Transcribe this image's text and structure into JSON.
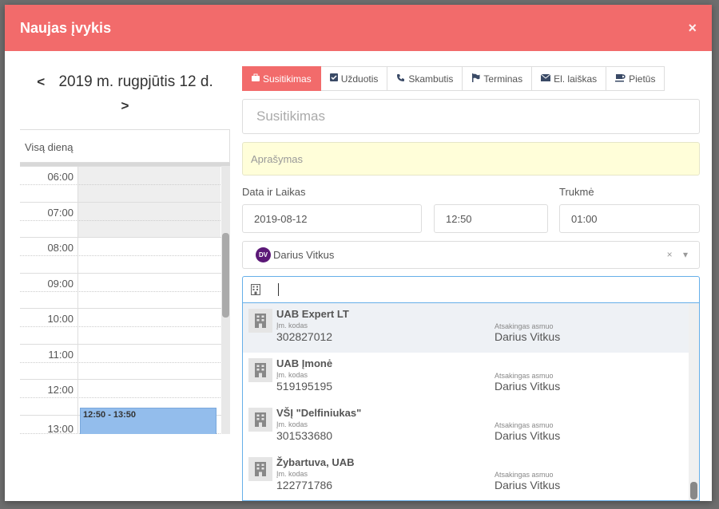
{
  "modal": {
    "title": "Naujas įvykis",
    "close": "×"
  },
  "calendar": {
    "date": "2019 m. rugpjūtis 12 d.",
    "prev": "<",
    "next": ">",
    "allday_label": "Visą dieną",
    "hours": [
      "06:00",
      "07:00",
      "08:00",
      "09:00",
      "10:00",
      "11:00",
      "12:00",
      "13:00"
    ],
    "event_label": "12:50 - 13:50"
  },
  "tabs": [
    {
      "label": "Susitikimas",
      "icon": "briefcase-icon"
    },
    {
      "label": "Užduotis",
      "icon": "checkbox-icon"
    },
    {
      "label": "Skambutis",
      "icon": "phone-icon"
    },
    {
      "label": "Terminas",
      "icon": "flag-icon"
    },
    {
      "label": "El. laiškas",
      "icon": "envelope-icon"
    },
    {
      "label": "Pietūs",
      "icon": "coffee-icon"
    }
  ],
  "form": {
    "title_placeholder": "Susitikimas",
    "description_placeholder": "Aprašymas",
    "datetime_label": "Data ir Laikas",
    "duration_label": "Trukmė",
    "date_value": "2019-08-12",
    "time_value": "12:50",
    "duration_value": "01:00",
    "person": {
      "initials": "DV",
      "name": "Darius Vitkus",
      "clear": "×",
      "toggle": "▾"
    }
  },
  "companies": [
    {
      "name": "UAB Expert LT",
      "code_label": "Įm. kodas",
      "code": "302827012",
      "resp_label": "Atsakingas asmuo",
      "resp": "Darius Vitkus"
    },
    {
      "name": "UAB Įmonė",
      "code_label": "Įm. kodas",
      "code": "519195195",
      "resp_label": "Atsakingas asmuo",
      "resp": "Darius Vitkus"
    },
    {
      "name": "VŠĮ \"Delfiniukas\"",
      "code_label": "Įm. kodas",
      "code": "301533680",
      "resp_label": "Atsakingas asmuo",
      "resp": "Darius Vitkus"
    },
    {
      "name": "Žybartuva, UAB",
      "code_label": "Įm. kodas",
      "code": "122771786",
      "resp_label": "Atsakingas asmuo",
      "resp": "Darius Vitkus"
    }
  ],
  "colors": {
    "accent": "#f26b6b",
    "event": "#93bdec",
    "avatar": "#5b1877",
    "description_bg": "#fffed9"
  }
}
